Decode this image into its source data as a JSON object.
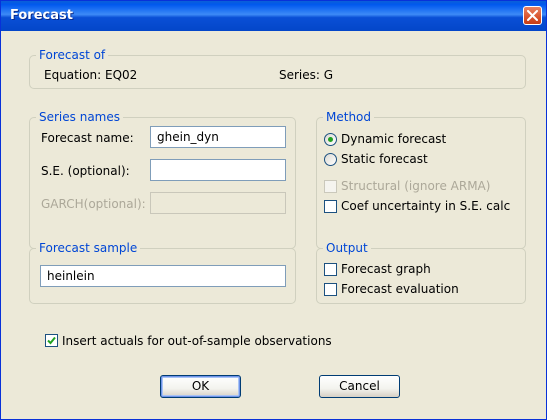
{
  "window": {
    "title": "Forecast"
  },
  "forecast_of": {
    "legend": "Forecast of",
    "equation": "Equation: EQ02",
    "series": "Series: G"
  },
  "series_names": {
    "legend": "Series names",
    "forecast_name_label": "Forecast name:",
    "forecast_name_value": "ghein_dyn",
    "se_label": "S.E. (optional):",
    "se_value": "",
    "garch_label": "GARCH(optional):",
    "garch_value": ""
  },
  "method": {
    "legend": "Method",
    "dynamic_label": "Dynamic forecast",
    "dynamic_selected": true,
    "static_label": "Static forecast",
    "static_selected": false,
    "structural_label": "Structural (ignore ARMA)",
    "structural_checked": false,
    "coef_label": "Coef uncertainty in S.E. calc",
    "coef_checked": false
  },
  "forecast_sample": {
    "legend": "Forecast sample",
    "value": "heinlein"
  },
  "output": {
    "legend": "Output",
    "graph_label": "Forecast graph",
    "graph_checked": false,
    "evaluation_label": "Forecast evaluation",
    "evaluation_checked": false
  },
  "insert_actuals": {
    "label": "Insert actuals for out-of-sample observations",
    "checked": true
  },
  "buttons": {
    "ok": "OK",
    "cancel": "Cancel"
  },
  "colors": {
    "title_bar": "#0058ee",
    "group_legend": "#0046d5",
    "dialog_bg": "#ece9d8",
    "radio_dot": "#21a121",
    "check_mark": "#21a121"
  }
}
